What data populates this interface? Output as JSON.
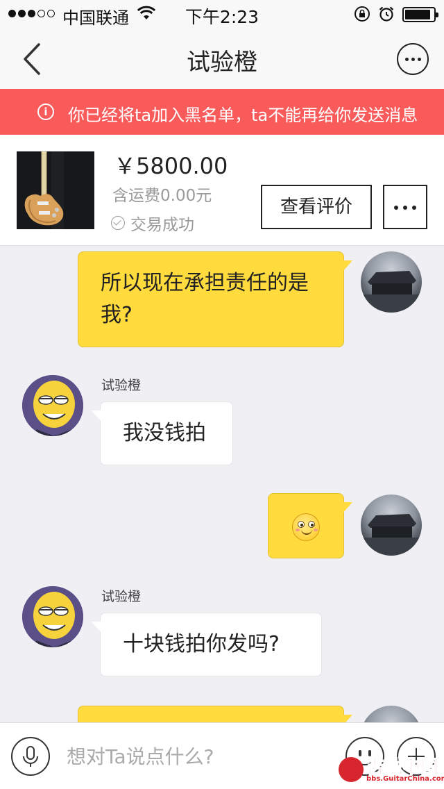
{
  "status_bar": {
    "carrier": "中国联通",
    "time": "下午2:23",
    "signal_bars_filled": 3,
    "signal_bars_total": 5
  },
  "nav": {
    "title": "试验橙",
    "back_icon": "chevron-left-icon",
    "more_icon": "more-horizontal-icon"
  },
  "banner": {
    "text": "你已经将ta加入黑名单，ta不能再给你发送消息",
    "icon": "info-icon",
    "background": "#f95b5b"
  },
  "product": {
    "price": "￥5800.00",
    "shipping": "含运费0.00元",
    "status": "交易成功",
    "review_button": "查看评价",
    "more_icon": "more-horizontal-icon"
  },
  "chat": {
    "messages": [
      {
        "direction": "out",
        "text": "所以现在承担责任的是我?"
      },
      {
        "direction": "in",
        "sender": "试验橙",
        "text": "我没钱拍"
      },
      {
        "direction": "out",
        "type": "emoji",
        "emoji": "smiley-emoji"
      },
      {
        "direction": "in",
        "sender": "试验橙",
        "text": "十块钱拍你发吗?"
      },
      {
        "direction": "out",
        "text": ""
      }
    ],
    "outgoing_bubble_color": "#ffdb3e",
    "incoming_bubble_color": "#ffffff"
  },
  "input_bar": {
    "placeholder": "想对Ta说点什么?",
    "voice_icon": "microphone-icon",
    "emoji_icon": "smiley-icon",
    "plus_icon": "plus-icon"
  },
  "watermark": {
    "title": "吉他中国",
    "url": "bbs.GuitarChina.com"
  }
}
